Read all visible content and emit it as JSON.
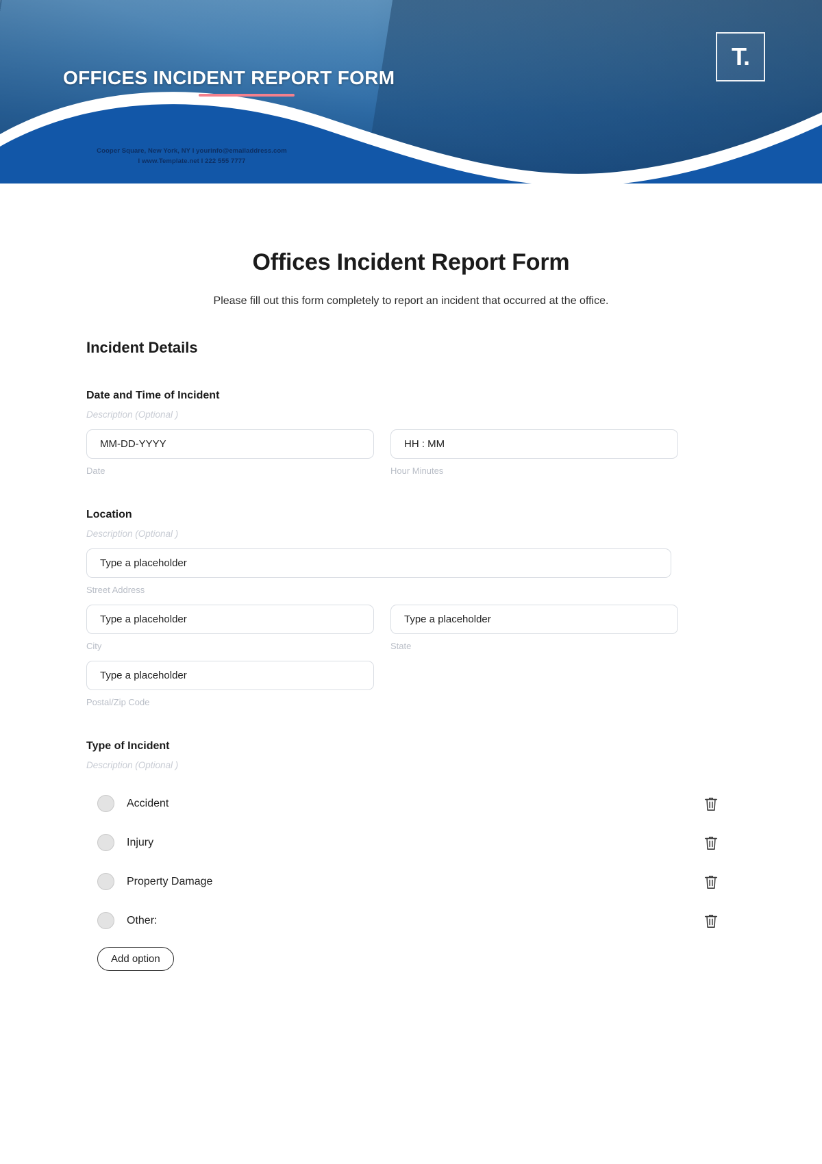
{
  "banner": {
    "title": "OFFICES INCIDENT REPORT FORM",
    "logo_mark": "T.",
    "contact_line_1": "Cooper Square, New York, NY I  yourinfo@emailaddress.com",
    "contact_line_2": "I  www.Template.net  I  222 555 7777",
    "accent_color": "#f4808c",
    "brand_blue": "#1257a8"
  },
  "document": {
    "title": "Offices Incident Report Form",
    "subtitle": "Please fill out this form completely to report an incident that occurred at the office.",
    "section_title": "Incident Details"
  },
  "fields": {
    "datetime": {
      "label": "Date and Time of Incident",
      "description": "Description  (Optional )",
      "date_value": "MM-DD-YYYY",
      "date_hint": "Date",
      "time_value": "HH : MM",
      "time_hint": "Hour Minutes"
    },
    "location": {
      "label": "Location",
      "description": "Description  (Optional )",
      "street_value": "Type a placeholder",
      "street_hint": "Street Address",
      "city_value": "Type a placeholder",
      "city_hint": "City",
      "state_value": "Type a placeholder",
      "state_hint": "State",
      "zip_value": "Type a placeholder",
      "zip_hint": "Postal/Zip Code"
    },
    "incident_type": {
      "label": "Type of Incident",
      "description": "Description  (Optional )",
      "options": [
        {
          "label": "Accident",
          "delete_icon": "trash-icon"
        },
        {
          "label": "Injury",
          "delete_icon": "trash-icon"
        },
        {
          "label": "Property Damage",
          "delete_icon": "trash-icon"
        },
        {
          "label": "Other:",
          "delete_icon": "trash-icon"
        }
      ],
      "add_option_label": "Add option"
    }
  }
}
